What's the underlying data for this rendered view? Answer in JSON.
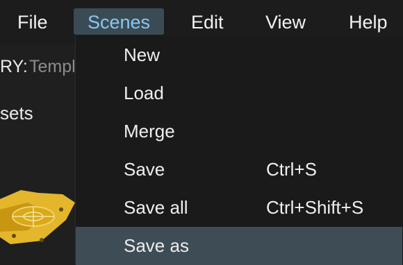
{
  "menubar": {
    "items": [
      "File",
      "Scenes",
      "Edit",
      "View",
      "Help"
    ],
    "active": "Scenes"
  },
  "background": {
    "field_label": "RY:",
    "field_value": "Templ",
    "assets_label": "sets"
  },
  "dropdown": {
    "items": [
      {
        "label": "New",
        "shortcut": ""
      },
      {
        "label": "Load",
        "shortcut": ""
      },
      {
        "label": "Merge",
        "shortcut": ""
      },
      {
        "label": "Save",
        "shortcut": "Ctrl+S"
      },
      {
        "label": "Save all",
        "shortcut": "Ctrl+Shift+S"
      },
      {
        "label": "Save as",
        "shortcut": ""
      }
    ],
    "hovered": "Save as"
  },
  "colors": {
    "active_menu_bg": "#3b4b55",
    "active_menu_text": "#86c9ef",
    "hover_item_bg": "#3e4d55"
  }
}
